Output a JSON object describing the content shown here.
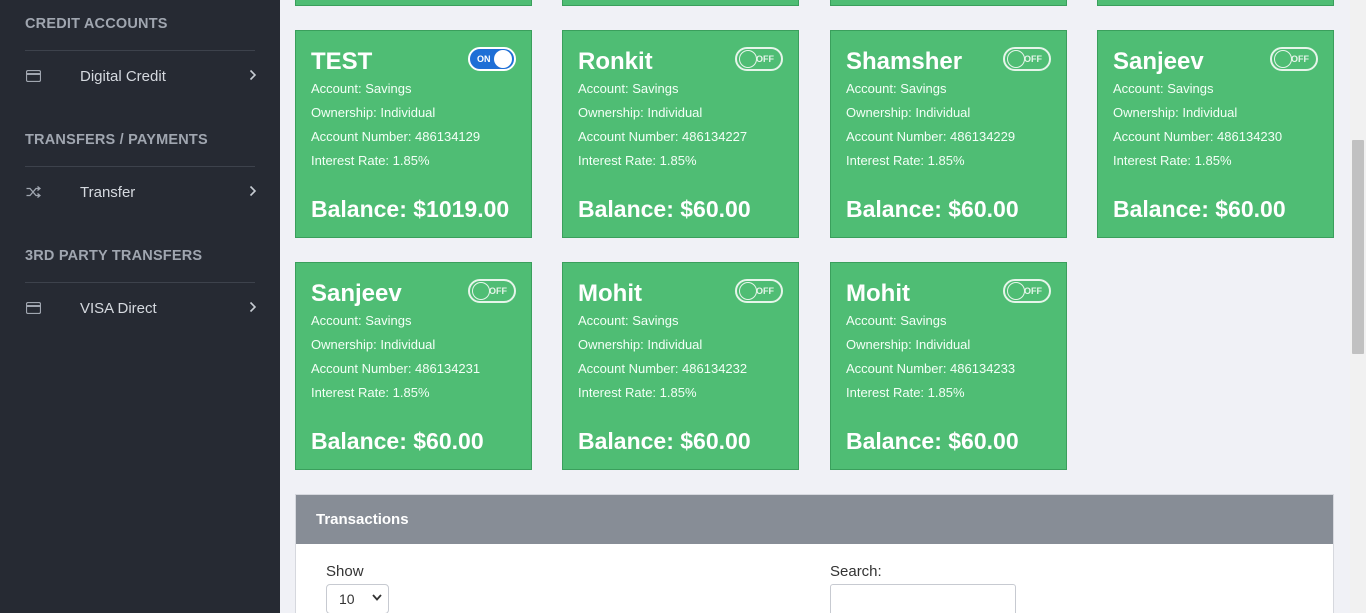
{
  "sidebar": {
    "sections": [
      {
        "heading": "CREDIT ACCOUNTS",
        "item": {
          "label": "Digital Credit",
          "icon": "credit-card-icon"
        }
      },
      {
        "heading": "TRANSFERS / PAYMENTS",
        "item": {
          "label": "Transfer",
          "icon": "shuffle-icon"
        }
      },
      {
        "heading": "3RD PARTY TRANSFERS",
        "item": {
          "label": "VISA Direct",
          "icon": "credit-card-icon"
        }
      }
    ]
  },
  "accounts": [
    {
      "name": "TEST",
      "toggle": "ON",
      "account": "Account: Savings",
      "ownership": "Ownership: Individual",
      "number": "Account Number: 486134129",
      "rate": "Interest Rate: 1.85%",
      "balance": "Balance: $1019.00"
    },
    {
      "name": "Ronkit",
      "toggle": "OFF",
      "account": "Account: Savings",
      "ownership": "Ownership: Individual",
      "number": "Account Number: 486134227",
      "rate": "Interest Rate: 1.85%",
      "balance": "Balance: $60.00"
    },
    {
      "name": "Shamsher",
      "toggle": "OFF",
      "account": "Account: Savings",
      "ownership": "Ownership: Individual",
      "number": "Account Number: 486134229",
      "rate": "Interest Rate: 1.85%",
      "balance": "Balance: $60.00"
    },
    {
      "name": "Sanjeev",
      "toggle": "OFF",
      "account": "Account: Savings",
      "ownership": "Ownership: Individual",
      "number": "Account Number: 486134230",
      "rate": "Interest Rate: 1.85%",
      "balance": "Balance: $60.00"
    },
    {
      "name": "Sanjeev",
      "toggle": "OFF",
      "account": "Account: Savings",
      "ownership": "Ownership: Individual",
      "number": "Account Number: 486134231",
      "rate": "Interest Rate: 1.85%",
      "balance": "Balance: $60.00"
    },
    {
      "name": "Mohit",
      "toggle": "OFF",
      "account": "Account: Savings",
      "ownership": "Ownership: Individual",
      "number": "Account Number: 486134232",
      "rate": "Interest Rate: 1.85%",
      "balance": "Balance: $60.00"
    },
    {
      "name": "Mohit",
      "toggle": "OFF",
      "account": "Account: Savings",
      "ownership": "Ownership: Individual",
      "number": "Account Number: 486134233",
      "rate": "Interest Rate: 1.85%",
      "balance": "Balance: $60.00"
    }
  ],
  "transactions": {
    "title": "Transactions",
    "show_label": "Show",
    "page_size": "10",
    "search_label": "Search:",
    "search_value": ""
  },
  "colors": {
    "sidebar_bg": "#262a33",
    "card_bg": "#4fbd74",
    "toggle_on": "#1e6fd6",
    "panel_header": "#878d96"
  }
}
